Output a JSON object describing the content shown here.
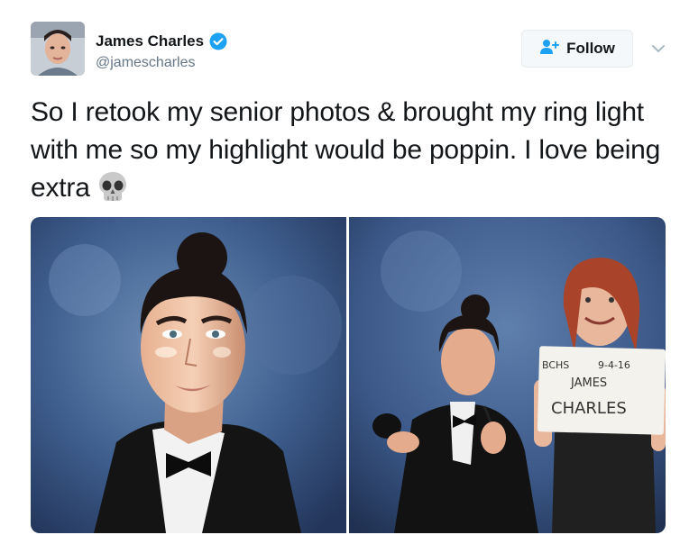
{
  "author": {
    "name": "James Charles",
    "handle": "@jamescharles",
    "verified": true
  },
  "follow_button": {
    "label": "Follow"
  },
  "tweet": {
    "text": "So I retook my senior photos & brought my ring light with me so my highlight would be poppin. I love being extra",
    "emoji_icon": "skull-emoji-icon"
  },
  "photos": {
    "sign": {
      "line1_left": "BCHS",
      "line1_right": "9-4-16",
      "line2": "JAMES",
      "line3": "CHARLES"
    }
  },
  "colors": {
    "verified_blue": "#1da1f2",
    "follow_bg": "#f5f8fa",
    "handle_gray": "#657786",
    "backdrop_blue": "#3e5f8c"
  }
}
